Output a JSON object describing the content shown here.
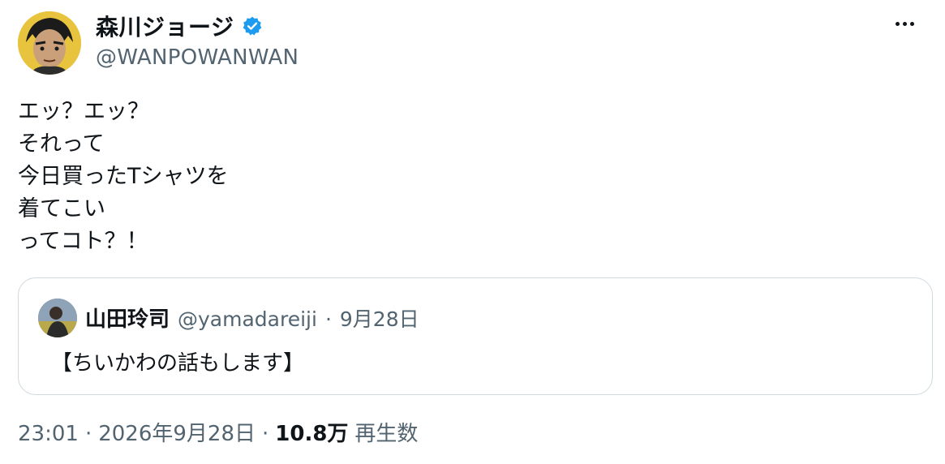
{
  "author": {
    "name": "森川ジョージ",
    "handle": "@WANPOWANWAN",
    "verified": true
  },
  "tweet": {
    "lines": [
      "エッ？エッ？",
      "それって",
      "今日買ったTシャツを",
      "着てこい",
      "ってコト？！"
    ]
  },
  "quote": {
    "name": "山田玲司",
    "handle": "@yamadareiji",
    "separator": "·",
    "date": "9月28日",
    "text": "【ちいかわの話もします】"
  },
  "footer": {
    "time": "23:01",
    "separator": "·",
    "date": "2026年9月28日",
    "views_count": "10.8万",
    "views_label": "再生数"
  },
  "colors": {
    "text_primary": "#0f1419",
    "text_secondary": "#536471",
    "verified_blue": "#1d9bf0",
    "border": "#cfd9de"
  }
}
